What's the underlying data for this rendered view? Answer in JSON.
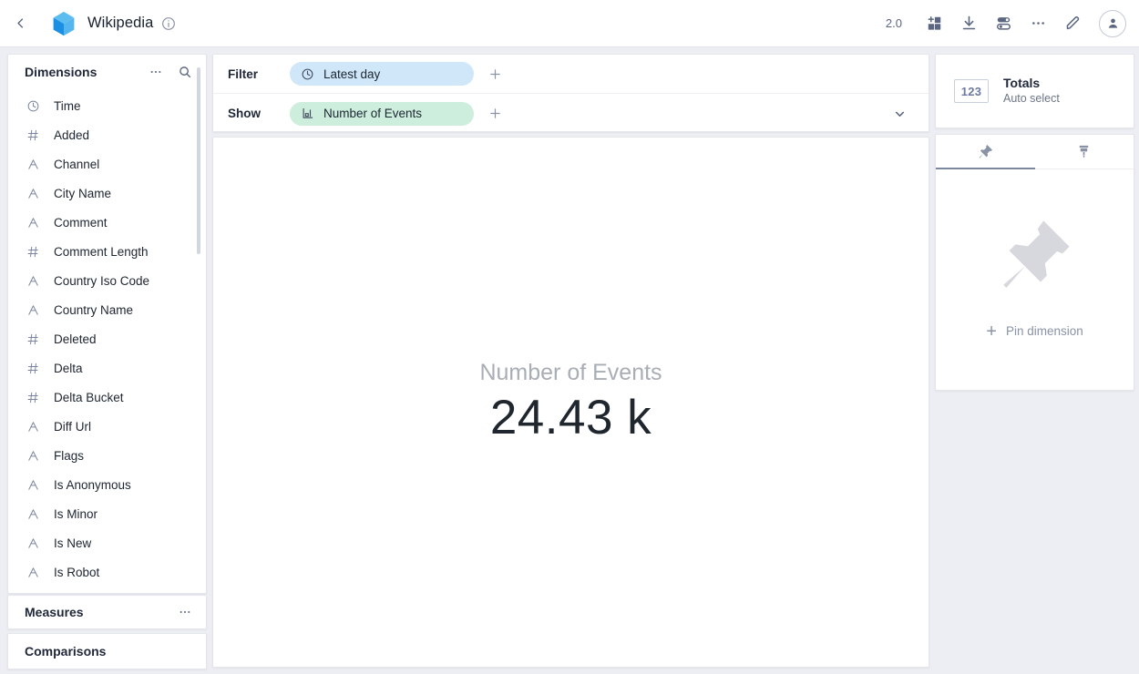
{
  "header": {
    "back_icon": "chevron-left-icon",
    "logo_icon": "cube-logo-icon",
    "title": "Wikipedia",
    "info_icon": "info-icon",
    "version": "2.0",
    "actions": [
      {
        "name": "add-tile-button",
        "icon": "add-tile-icon"
      },
      {
        "name": "download-button",
        "icon": "download-icon"
      },
      {
        "name": "settings-button",
        "icon": "toggles-icon"
      },
      {
        "name": "more-options-button",
        "icon": "ellipsis-icon"
      },
      {
        "name": "edit-button",
        "icon": "pencil-icon"
      }
    ],
    "avatar_icon": "user-avatar-icon"
  },
  "sidebar": {
    "dimensions": {
      "title": "Dimensions",
      "more_icon": "ellipsis-icon",
      "search_icon": "search-icon",
      "items": [
        {
          "label": "Time",
          "type": "time"
        },
        {
          "label": "Added",
          "type": "number"
        },
        {
          "label": "Channel",
          "type": "string"
        },
        {
          "label": "City Name",
          "type": "string"
        },
        {
          "label": "Comment",
          "type": "string"
        },
        {
          "label": "Comment Length",
          "type": "number"
        },
        {
          "label": "Country Iso Code",
          "type": "string"
        },
        {
          "label": "Country Name",
          "type": "string"
        },
        {
          "label": "Deleted",
          "type": "number"
        },
        {
          "label": "Delta",
          "type": "number"
        },
        {
          "label": "Delta Bucket",
          "type": "number"
        },
        {
          "label": "Diff Url",
          "type": "string"
        },
        {
          "label": "Flags",
          "type": "string"
        },
        {
          "label": "Is Anonymous",
          "type": "string"
        },
        {
          "label": "Is Minor",
          "type": "string"
        },
        {
          "label": "Is New",
          "type": "string"
        },
        {
          "label": "Is Robot",
          "type": "string"
        }
      ]
    },
    "measures": {
      "title": "Measures",
      "more_icon": "ellipsis-icon"
    },
    "comparisons": {
      "title": "Comparisons"
    }
  },
  "query": {
    "filter": {
      "label": "Filter",
      "pill": {
        "text": "Latest day",
        "icon": "clock-icon",
        "color": "#cfe7f8"
      },
      "add_icon": "plus-icon"
    },
    "show": {
      "label": "Show",
      "pill": {
        "text": "Number of Events",
        "icon": "bar-chart-icon",
        "color": "#cdeedd"
      },
      "add_icon": "plus-icon",
      "chevron_icon": "chevron-down-icon"
    }
  },
  "visualization": {
    "metric_label": "Number of Events",
    "metric_value": "24.43 k"
  },
  "right_panel": {
    "totals": {
      "badge": "123",
      "title": "Totals",
      "subtitle": "Auto select"
    },
    "tabs": [
      {
        "name": "pin-tab",
        "icon": "pin-icon",
        "active": true
      },
      {
        "name": "format-tab",
        "icon": "paint-brush-icon",
        "active": false
      }
    ],
    "pin_placeholder": {
      "icon": "pin-large-icon",
      "add_label": "Pin dimension",
      "plus": "+"
    }
  }
}
